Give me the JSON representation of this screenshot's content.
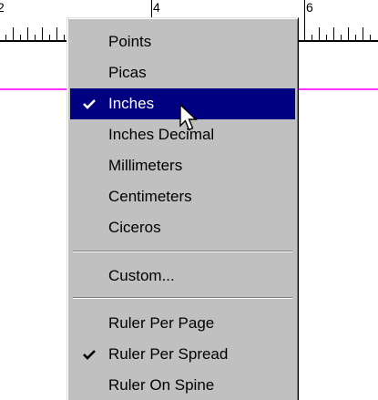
{
  "ruler": {
    "labels": [
      "2",
      "4",
      "6"
    ]
  },
  "menu": {
    "items": [
      {
        "label": "Points",
        "checked": false,
        "selected": false
      },
      {
        "label": "Picas",
        "checked": false,
        "selected": false
      },
      {
        "label": "Inches",
        "checked": true,
        "selected": true
      },
      {
        "label": "Inches Decimal",
        "checked": false,
        "selected": false
      },
      {
        "label": "Millimeters",
        "checked": false,
        "selected": false
      },
      {
        "label": "Centimeters",
        "checked": false,
        "selected": false
      },
      {
        "label": "Ciceros",
        "checked": false,
        "selected": false
      },
      {
        "label": "Custom...",
        "checked": false,
        "selected": false
      },
      {
        "label": "Ruler Per Page",
        "checked": false,
        "selected": false
      },
      {
        "label": "Ruler Per Spread",
        "checked": true,
        "selected": false
      },
      {
        "label": "Ruler On Spine",
        "checked": false,
        "selected": false
      }
    ]
  },
  "colors": {
    "menu_background": "#c0c0c0",
    "highlight": "#000080",
    "guide": "#ff33ff"
  },
  "icons": {
    "check": "check-icon",
    "pointer": "mouse-pointer-icon"
  }
}
